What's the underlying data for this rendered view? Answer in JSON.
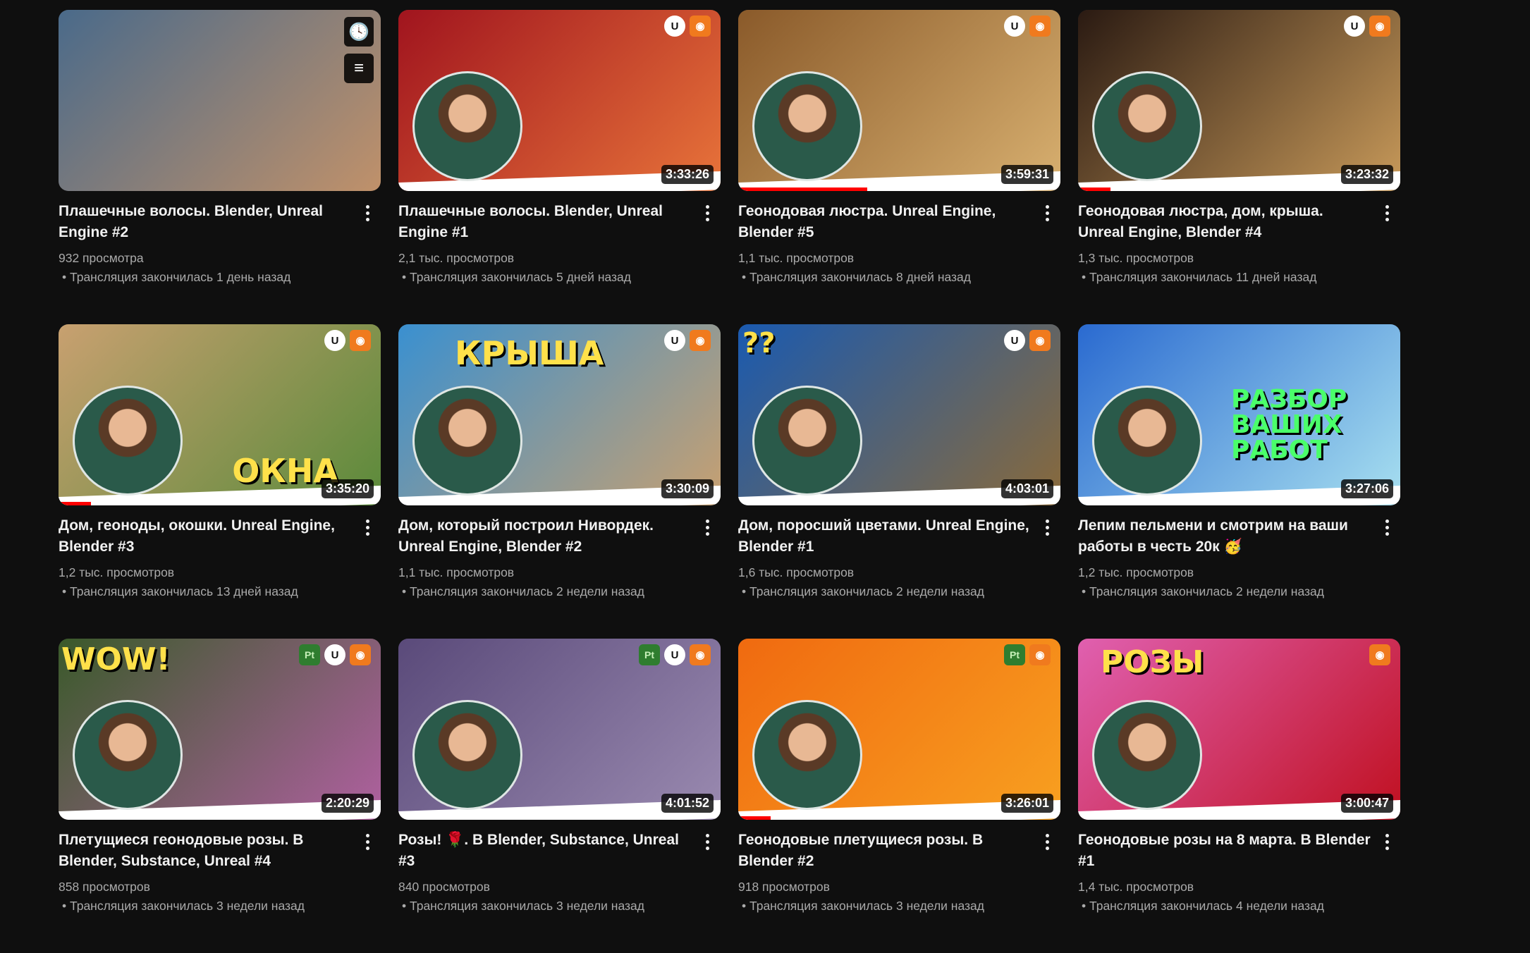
{
  "videos": [
    {
      "title": "Плашечные волосы. Blender, Unreal Engine #2",
      "views": "932 просмотра",
      "streamed": "Трансляция закончилась 1 день назад",
      "duration": "",
      "badges": [],
      "hover": true,
      "overlay": "",
      "colors": [
        "#4a6a8a",
        "#c0916a"
      ],
      "progress": 0
    },
    {
      "title": "Плашечные волосы. Blender, Unreal Engine #1",
      "views": "2,1 тыс. просмотров",
      "streamed": "Трансляция закончилась 5 дней назад",
      "duration": "3:33:26",
      "badges": [
        "ue",
        "bl"
      ],
      "overlay": "",
      "colors": [
        "#a0141e",
        "#e8743a"
      ],
      "progress": 0
    },
    {
      "title": "Геонодовая люстра. Unreal Engine, Blender #5",
      "views": "1,1 тыс. просмотров",
      "streamed": "Трансляция закончилась 8 дней назад",
      "duration": "3:59:31",
      "badges": [
        "ue",
        "bl"
      ],
      "overlay": "",
      "colors": [
        "#8a5a2a",
        "#d8b070"
      ],
      "progress": 0.4
    },
    {
      "title": "Геонодовая люстра, дом, крыша. Unreal Engine, Blender #4",
      "views": "1,3 тыс. просмотров",
      "streamed": "Трансляция закончилась 11 дней назад",
      "duration": "3:23:32",
      "badges": [
        "ue",
        "bl"
      ],
      "overlay": "",
      "colors": [
        "#2a1a12",
        "#c89a5a"
      ],
      "progress": 0.1
    },
    {
      "title": "Дом, геоноды, окошки. Unreal Engine, Blender #3",
      "views": "1,2 тыс. просмотров",
      "streamed": "Трансляция закончилась 13 дней назад",
      "duration": "3:35:20",
      "badges": [
        "ue",
        "bl"
      ],
      "overlay": "ОКНА",
      "colors": [
        "#c8a070",
        "#5a8a3a"
      ],
      "progress": 0.1
    },
    {
      "title": "Дом, который построил Нивордек. Unreal Engine, Blender #2",
      "views": "1,1 тыс. просмотров",
      "streamed": "Трансляция закончилась 2 недели назад",
      "duration": "3:30:09",
      "badges": [
        "ue",
        "bl"
      ],
      "overlay": "КРЫША",
      "colors": [
        "#3a90d0",
        "#c8a070"
      ],
      "progress": 0
    },
    {
      "title": "Дом, поросший цветами. Unreal Engine, Blender #1",
      "views": "1,6 тыс. просмотров",
      "streamed": "Трансляция закончилась 2 недели назад",
      "duration": "4:03:01",
      "badges": [
        "ue",
        "bl"
      ],
      "overlay": "??",
      "colors": [
        "#1a5ab0",
        "#8a6a3a"
      ],
      "progress": 0
    },
    {
      "title": "Лепим пельмени и смотрим на ваши работы в честь 20к 🥳",
      "views": "1,2 тыс. просмотров",
      "streamed": "Трансляция закончилась 2 недели назад",
      "duration": "3:27:06",
      "badges": [],
      "overlay": "РАЗБОР ВАШИХ РАБОТ",
      "colors": [
        "#2a6ad0",
        "#a8e0f0"
      ],
      "progress": 0
    },
    {
      "title": "Плетущиеся геонодовые розы. В Blender, Substance, Unreal #4",
      "views": "858 просмотров",
      "streamed": "Трансляция закончилась 3 недели назад",
      "duration": "2:20:29",
      "badges": [
        "pt",
        "ue",
        "bl"
      ],
      "overlay": "WOW!",
      "colors": [
        "#3a5a2a",
        "#b060a0"
      ],
      "progress": 0
    },
    {
      "title": "Розы! 🌹. В Blender, Substance, Unreal #3",
      "views": "840 просмотров",
      "streamed": "Трансляция закончилась 3 недели назад",
      "duration": "4:01:52",
      "badges": [
        "pt",
        "ue",
        "bl"
      ],
      "overlay": "",
      "colors": [
        "#5a4a7a",
        "#9a8ab0"
      ],
      "progress": 0
    },
    {
      "title": "Геонодовые плетущиеся розы. В Blender #2",
      "views": "918 просмотров",
      "streamed": "Трансляция закончилась 3 недели назад",
      "duration": "3:26:01",
      "badges": [
        "pt",
        "bl"
      ],
      "overlay": "",
      "colors": [
        "#f06a10",
        "#f8a020"
      ],
      "progress": 0.1
    },
    {
      "title": "Геонодовые розы на 8 марта. В Blender #1",
      "views": "1,4 тыс. просмотров",
      "streamed": "Трансляция закончилась 4 недели назад",
      "duration": "3:00:47",
      "badges": [
        "bl"
      ],
      "overlay": "РОЗЫ",
      "colors": [
        "#e060b0",
        "#c01020"
      ],
      "progress": 0
    }
  ]
}
